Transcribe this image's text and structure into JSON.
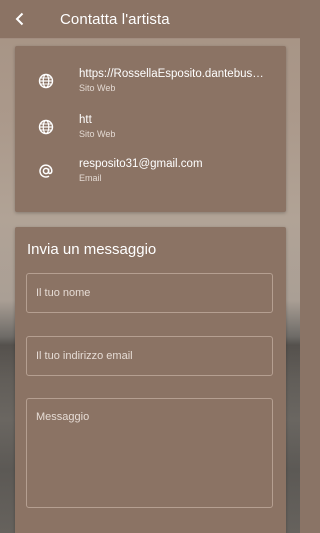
{
  "header": {
    "title": "Contatta l'artista"
  },
  "contacts": [
    {
      "icon": "globe-icon",
      "value": "https://RossellaEsposito.dantebus…",
      "label": "Sito Web"
    },
    {
      "icon": "globe-icon",
      "value": "htt",
      "label": "Sito Web"
    },
    {
      "icon": "at-icon",
      "value": "resposito31@gmail.com",
      "label": "Email"
    }
  ],
  "message": {
    "title": "Invia un messaggio",
    "name_placeholder": "Il tuo nome",
    "email_placeholder": "Il tuo indirizzo email",
    "message_placeholder": "Messaggio"
  },
  "colors": {
    "card": "#8b7364",
    "header": "#8b7364",
    "text": "#ffffff"
  }
}
